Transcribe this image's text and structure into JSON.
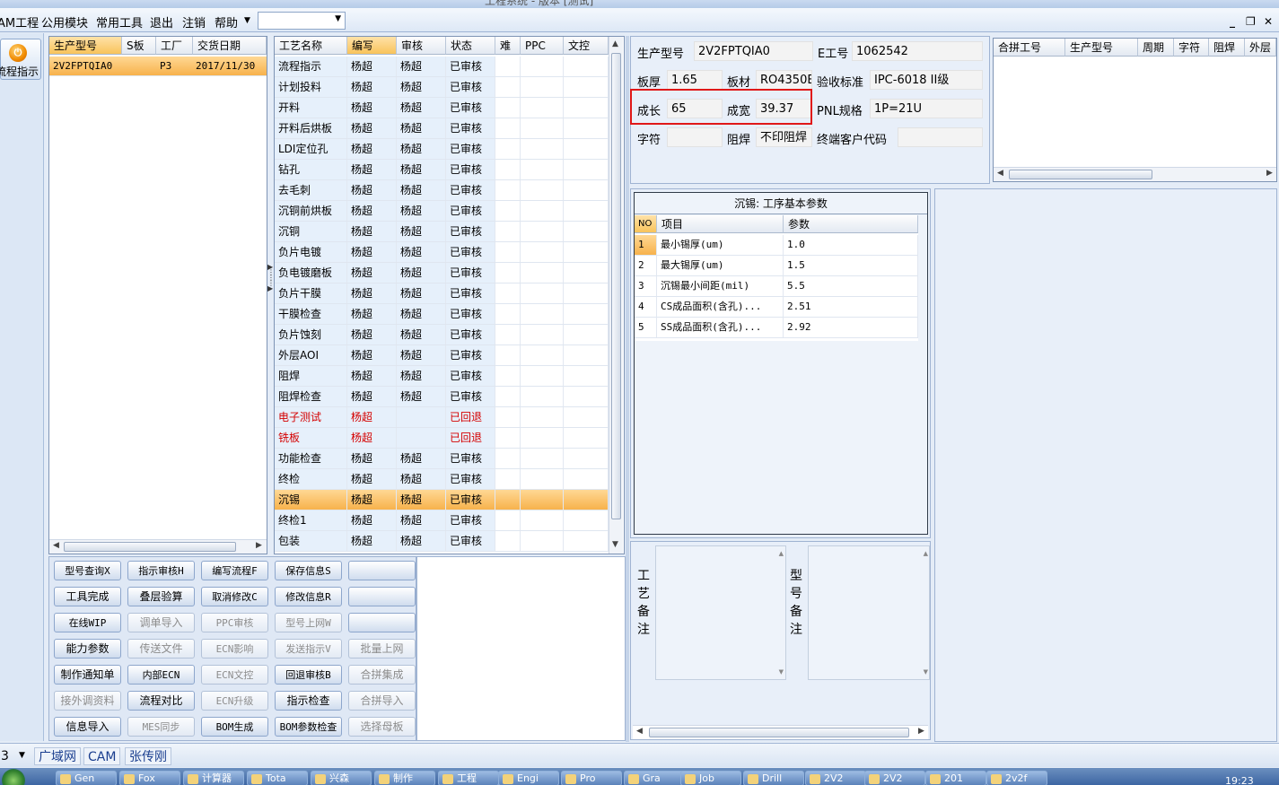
{
  "window": {
    "title": "工程系统 - 版本 [测试]"
  },
  "menu": {
    "items": [
      "AM工程",
      "公用模块",
      "常用工具",
      "退出",
      "注销",
      "帮助"
    ],
    "combo_value": ""
  },
  "flow_button": {
    "label": "流程指示"
  },
  "part_list": {
    "columns": [
      "生产型号",
      "S板",
      "工厂",
      "交货日期"
    ],
    "rows": [
      {
        "model": "2V2FPTQIA0",
        "s_board": "",
        "factory": "P3",
        "date": "2017/11/30"
      }
    ]
  },
  "process_table": {
    "columns": [
      "工艺名称",
      "编写",
      "审核",
      "状态",
      "难",
      "PPC",
      "文控"
    ],
    "rows": [
      {
        "name": "流程指示",
        "writer": "杨超",
        "reviewer": "杨超",
        "status": "已审核"
      },
      {
        "name": "计划投料",
        "writer": "杨超",
        "reviewer": "杨超",
        "status": "已审核"
      },
      {
        "name": "开料",
        "writer": "杨超",
        "reviewer": "杨超",
        "status": "已审核"
      },
      {
        "name": "开料后烘板",
        "writer": "杨超",
        "reviewer": "杨超",
        "status": "已审核"
      },
      {
        "name": "LDI定位孔",
        "writer": "杨超",
        "reviewer": "杨超",
        "status": "已审核"
      },
      {
        "name": "钻孔",
        "writer": "杨超",
        "reviewer": "杨超",
        "status": "已审核"
      },
      {
        "name": "去毛刺",
        "writer": "杨超",
        "reviewer": "杨超",
        "status": "已审核"
      },
      {
        "name": "沉铜前烘板",
        "writer": "杨超",
        "reviewer": "杨超",
        "status": "已审核"
      },
      {
        "name": "沉铜",
        "writer": "杨超",
        "reviewer": "杨超",
        "status": "已审核"
      },
      {
        "name": "负片电镀",
        "writer": "杨超",
        "reviewer": "杨超",
        "status": "已审核"
      },
      {
        "name": "负电镀磨板",
        "writer": "杨超",
        "reviewer": "杨超",
        "status": "已审核"
      },
      {
        "name": "负片干膜",
        "writer": "杨超",
        "reviewer": "杨超",
        "status": "已审核"
      },
      {
        "name": "干膜检查",
        "writer": "杨超",
        "reviewer": "杨超",
        "status": "已审核"
      },
      {
        "name": "负片蚀刻",
        "writer": "杨超",
        "reviewer": "杨超",
        "status": "已审核"
      },
      {
        "name": "外层AOI",
        "writer": "杨超",
        "reviewer": "杨超",
        "status": "已审核"
      },
      {
        "name": "阻焊",
        "writer": "杨超",
        "reviewer": "杨超",
        "status": "已审核"
      },
      {
        "name": "阻焊检查",
        "writer": "杨超",
        "reviewer": "杨超",
        "status": "已审核"
      },
      {
        "name": "电子测试",
        "writer": "杨超",
        "reviewer": "",
        "status": "已回退"
      },
      {
        "name": "铣板",
        "writer": "杨超",
        "reviewer": "",
        "status": "已回退"
      },
      {
        "name": "功能检查",
        "writer": "杨超",
        "reviewer": "杨超",
        "status": "已审核"
      },
      {
        "name": "终检",
        "writer": "杨超",
        "reviewer": "杨超",
        "status": "已审核"
      },
      {
        "name": "沉锡",
        "writer": "杨超",
        "reviewer": "杨超",
        "status": "已审核"
      },
      {
        "name": "终检1",
        "writer": "杨超",
        "reviewer": "杨超",
        "status": "已审核"
      },
      {
        "name": "包装",
        "writer": "杨超",
        "reviewer": "杨超",
        "status": "已审核"
      }
    ]
  },
  "buttons": [
    {
      "label": "型号查询X",
      "enabled": true
    },
    {
      "label": "指示审核H",
      "enabled": true
    },
    {
      "label": "编写流程F",
      "enabled": true
    },
    {
      "label": "保存信息S",
      "enabled": true
    },
    {
      "label": "",
      "enabled": true
    },
    {
      "label": "工具完成",
      "enabled": true
    },
    {
      "label": "叠层验算",
      "enabled": true
    },
    {
      "label": "取消修改C",
      "enabled": true
    },
    {
      "label": "修改信息R",
      "enabled": true
    },
    {
      "label": "",
      "enabled": true
    },
    {
      "label": "在线WIP",
      "enabled": true
    },
    {
      "label": "调单导入",
      "enabled": false
    },
    {
      "label": "PPC审核",
      "enabled": false
    },
    {
      "label": "型号上网W",
      "enabled": false
    },
    {
      "label": "",
      "enabled": true
    },
    {
      "label": "能力参数",
      "enabled": true
    },
    {
      "label": "传送文件",
      "enabled": false
    },
    {
      "label": "ECN影响",
      "enabled": false
    },
    {
      "label": "发送指示V",
      "enabled": false
    },
    {
      "label": "批量上网",
      "enabled": false
    },
    {
      "label": "制作通知单",
      "enabled": true
    },
    {
      "label": "内部ECN",
      "enabled": true
    },
    {
      "label": "ECN文控",
      "enabled": false
    },
    {
      "label": "回退审核B",
      "enabled": true
    },
    {
      "label": "合拼集成",
      "enabled": false
    },
    {
      "label": "接外调资料",
      "enabled": false
    },
    {
      "label": "流程对比",
      "enabled": true
    },
    {
      "label": "ECN升级",
      "enabled": false
    },
    {
      "label": "指示检查",
      "enabled": true
    },
    {
      "label": "合拼导入",
      "enabled": false
    },
    {
      "label": "信息导入",
      "enabled": true
    },
    {
      "label": "MES同步",
      "enabled": false
    },
    {
      "label": "BOM生成",
      "enabled": true
    },
    {
      "label": "BOM参数检查",
      "enabled": true
    },
    {
      "label": "选择母板",
      "enabled": false
    }
  ],
  "info": {
    "model_label": "生产型号",
    "model_value": "2V2FPTQIA0",
    "eno_label": "E工号",
    "eno_value": "1062542",
    "thickness_label": "板厚",
    "thickness_value": "1.65",
    "material_label": "板材",
    "material_value": "RO4350B",
    "accept_label": "验收标准",
    "accept_value": "IPC-6018 II级",
    "length_label": "成长",
    "length_value": "65",
    "width_label": "成宽",
    "width_value": "39.37",
    "pnl_label": "PNL规格",
    "pnl_value": "1P=21U",
    "char_label": "字符",
    "char_value": "",
    "mask_label": "阻焊",
    "mask_value": "不印阻焊",
    "client_label": "终端客户代码",
    "client_value": ""
  },
  "merge_table": {
    "columns": [
      "合拼工号",
      "生产型号",
      "周期",
      "字符",
      "阻焊",
      "外层"
    ]
  },
  "params": {
    "title": "沉锡: 工序基本参数",
    "columns": [
      "NO",
      "项目",
      "参数"
    ],
    "rows": [
      {
        "no": "1",
        "item": "最小锡厚(um)",
        "value": "1.0"
      },
      {
        "no": "2",
        "item": "最大锡厚(um)",
        "value": "1.5"
      },
      {
        "no": "3",
        "item": "沉锡最小间距(mil)",
        "value": "5.5"
      },
      {
        "no": "4",
        "item": "CS成品面积(含孔)...",
        "value": "2.51"
      },
      {
        "no": "5",
        "item": "SS成品面积(含孔)...",
        "value": "2.92"
      }
    ]
  },
  "remarks": {
    "process_label": "工艺备注",
    "model_label": "型号备注"
  },
  "status_bar": {
    "index": "3",
    "items": [
      "广域网",
      "CAM",
      "张传刚"
    ]
  },
  "taskbar": {
    "items": [
      "Gen",
      "Fox",
      "计算器",
      "Tota",
      "兴森",
      "制作",
      "工程",
      "Engi",
      "Pro",
      "Gra",
      "Job",
      "Drill",
      "2V2",
      "2V2",
      "201",
      "2v2f"
    ],
    "clock": "19:23"
  }
}
